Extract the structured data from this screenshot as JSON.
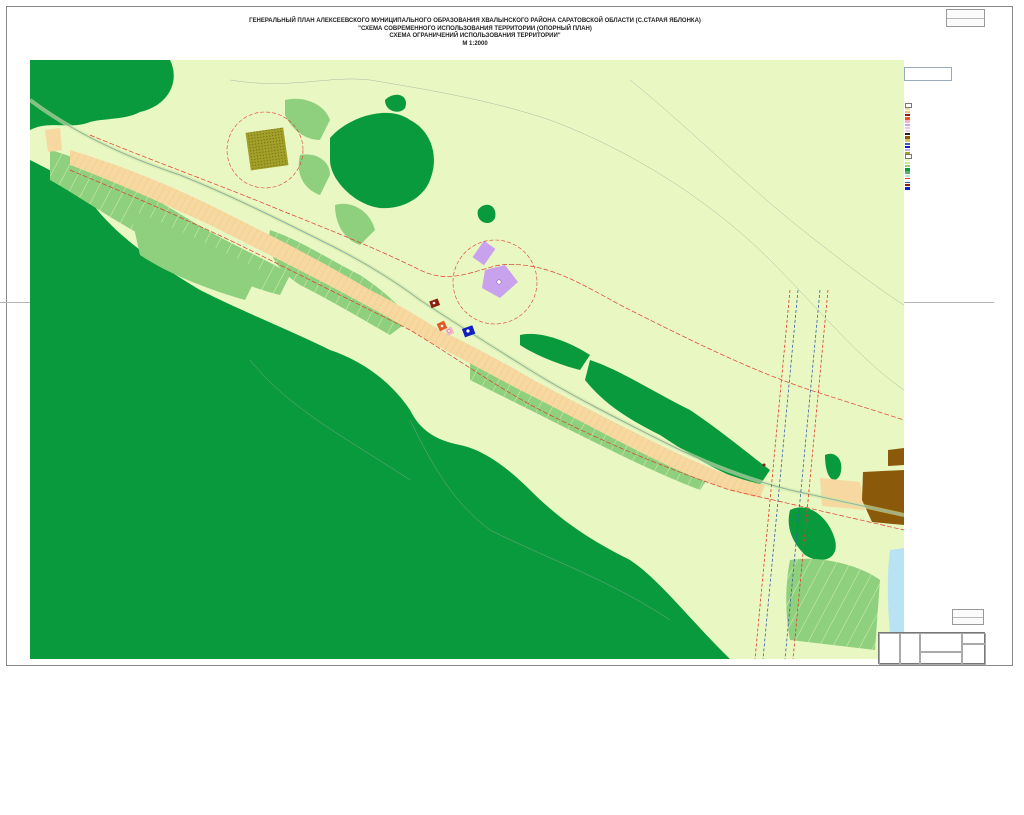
{
  "title": {
    "line1": "ГЕНЕРАЛЬНЫЙ ПЛАН АЛЕКСЕЕВСКОГО МУНИЦИПАЛЬНОГО ОБРАЗОВАНИЯ  ХВАЛЫНСКОГО РАЙОНА САРАТОВСКОЙ ОБЛАСТИ (С.СТАРАЯ ЯБЛОНКА)",
    "line2": "\"СХЕМА СОВРЕМЕННОГО ИСПОЛЬЗОВАНИЯ ТЕРРИТОРИИ (ОПОРНЫЙ ПЛАН)",
    "line3": "СХЕМА ОГРАНИЧЕНИЙ ИСПОЛЬЗОВАНИЯ ТЕРРИТОРИИ\"",
    "line4": "М 1:2000"
  },
  "map": {
    "colors": {
      "background": "#e9f7c3",
      "forest": "#0a9a3e",
      "meadow": "#8fd07e",
      "residential": "#f7d8a0",
      "roads": "#cfe8a0",
      "red_lines": "#e03a2a",
      "water": "#b8e3f2",
      "public_building": "#c9a2ee",
      "industrial_brown": "#8a5a0a",
      "cemetery_olive": "#a3a02a",
      "road_line": "#3a5fa8"
    },
    "icons": [
      "church-icon",
      "school-icon",
      "shop-icon",
      "fire-station-icon",
      "medical-icon"
    ]
  }
}
